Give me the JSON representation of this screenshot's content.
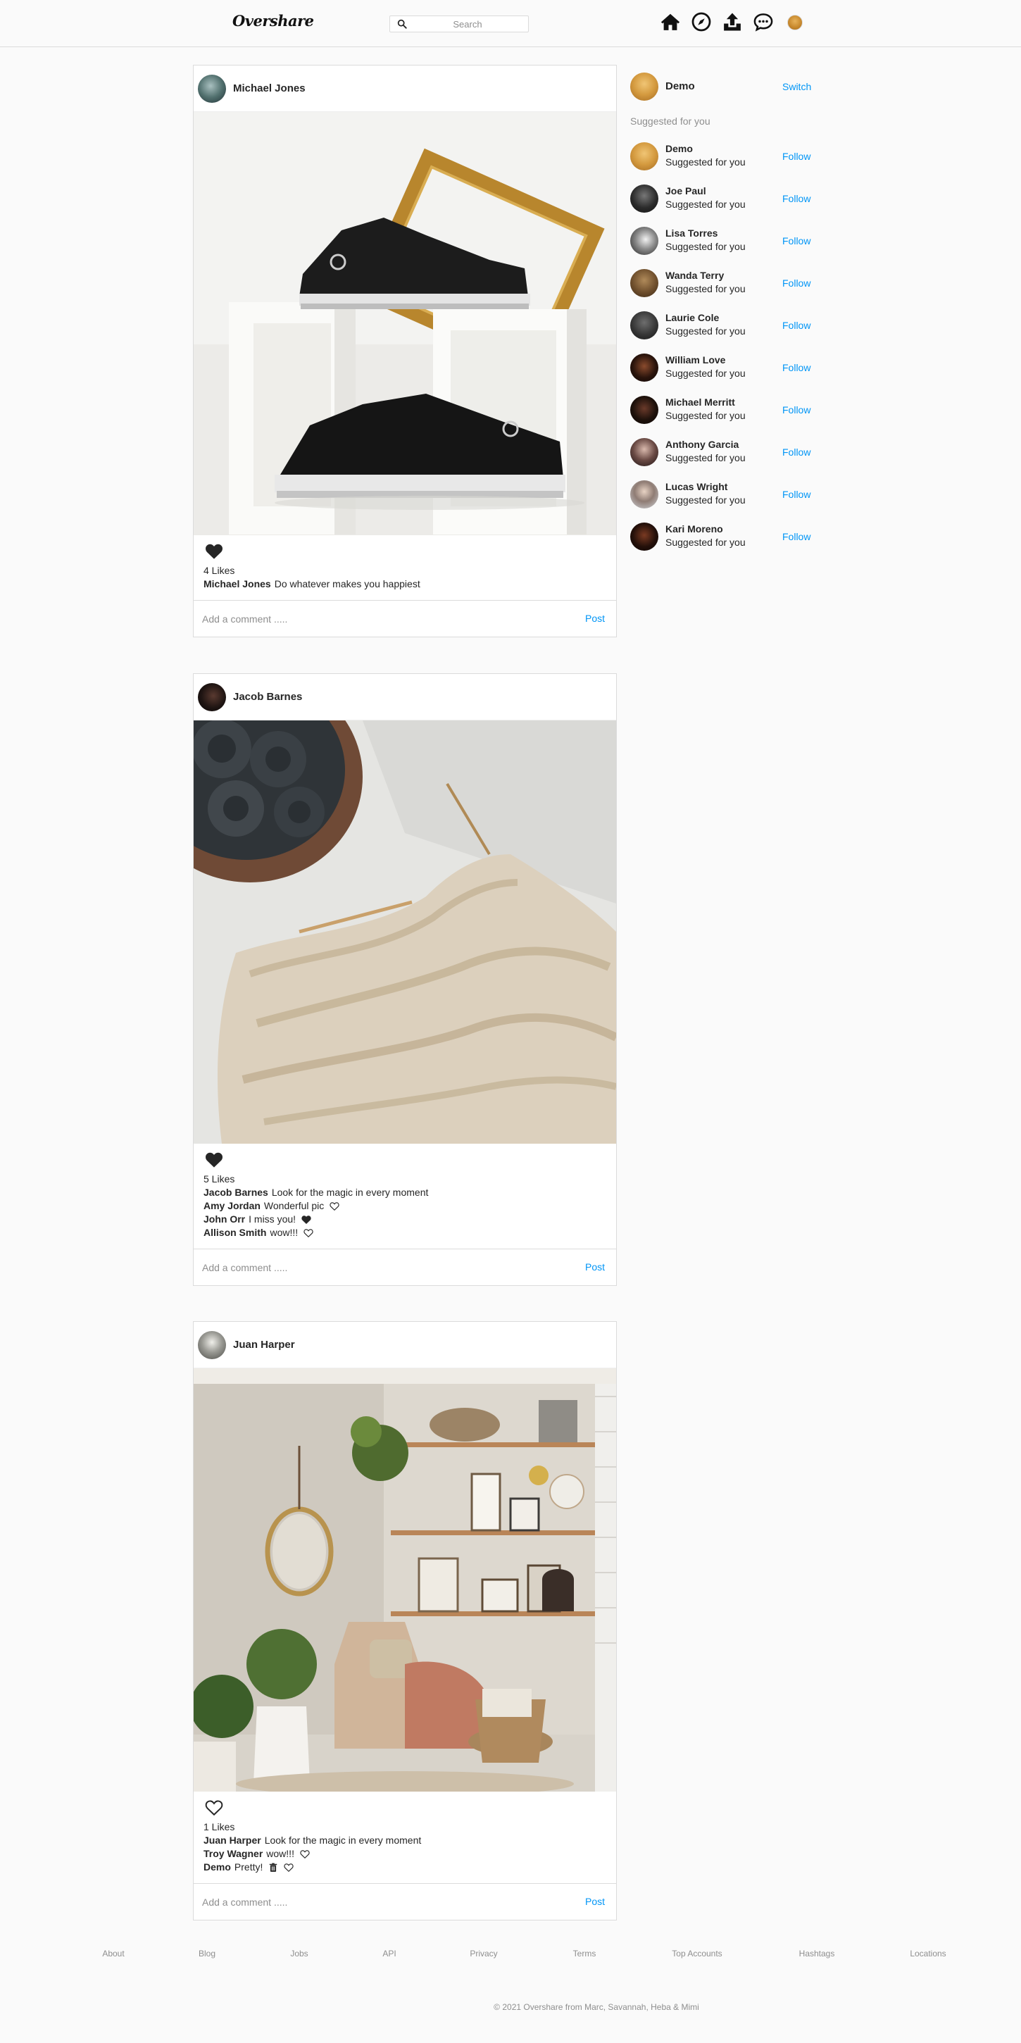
{
  "nav": {
    "logo": "Overshare",
    "search_placeholder": "Search",
    "icons": [
      "home-icon",
      "explore-icon",
      "upload-icon",
      "messages-icon"
    ]
  },
  "posts": [
    {
      "username": "Michael Jones",
      "liked": true,
      "likes": "4 Likes",
      "caption": {
        "user": "Michael Jones",
        "text": "Do whatever makes you happiest"
      },
      "comments": [],
      "comment_placeholder": "Add a comment .....",
      "post_label": "Post"
    },
    {
      "username": "Jacob Barnes",
      "liked": true,
      "likes": "5 Likes",
      "caption": {
        "user": "Jacob Barnes",
        "text": "Look for the magic in every moment"
      },
      "comments": [
        {
          "user": "Amy Jordan",
          "text": "Wonderful pic",
          "liked": false
        },
        {
          "user": "John Orr",
          "text": "I miss you!",
          "liked": true
        },
        {
          "user": "Allison Smith",
          "text": "wow!!!",
          "liked": false
        }
      ],
      "comment_placeholder": "Add a comment .....",
      "post_label": "Post"
    },
    {
      "username": "Juan Harper",
      "liked": false,
      "likes": "1 Likes",
      "caption": {
        "user": "Juan Harper",
        "text": "Look for the magic in every moment"
      },
      "comments": [
        {
          "user": "Troy Wagner",
          "text": "wow!!!",
          "liked": false
        },
        {
          "user": "Demo",
          "text": "Pretty!",
          "liked": false,
          "deletable": true
        }
      ],
      "comment_placeholder": "Add a comment .....",
      "post_label": "Post"
    }
  ],
  "sidebar": {
    "current_user": "Demo",
    "switch_label": "Switch",
    "suggestions_title": "Suggested for you",
    "follow_label": "Follow",
    "suggestions": [
      {
        "name": "Demo",
        "sub": "Suggested for you"
      },
      {
        "name": "Joe Paul",
        "sub": "Suggested for you"
      },
      {
        "name": "Lisa Torres",
        "sub": "Suggested for you"
      },
      {
        "name": "Wanda Terry",
        "sub": "Suggested for you"
      },
      {
        "name": "Laurie Cole",
        "sub": "Suggested for you"
      },
      {
        "name": "William Love",
        "sub": "Suggested for you"
      },
      {
        "name": "Michael Merritt",
        "sub": "Suggested for you"
      },
      {
        "name": "Anthony Garcia",
        "sub": "Suggested for you"
      },
      {
        "name": "Lucas Wright",
        "sub": "Suggested for you"
      },
      {
        "name": "Kari Moreno",
        "sub": "Suggested for you"
      }
    ]
  },
  "footer": {
    "links": [
      "About",
      "Blog",
      "Jobs",
      "API",
      "Privacy",
      "Terms",
      "Top Accounts",
      "Hashtags",
      "Locations"
    ],
    "copyright": "© 2021 Overshare from Marc, Savannah, Heba & Mimi"
  },
  "colors": {
    "accent": "#0095f6",
    "border": "#dbdbdb",
    "muted": "#8e8e8e",
    "background": "#fafafa"
  }
}
